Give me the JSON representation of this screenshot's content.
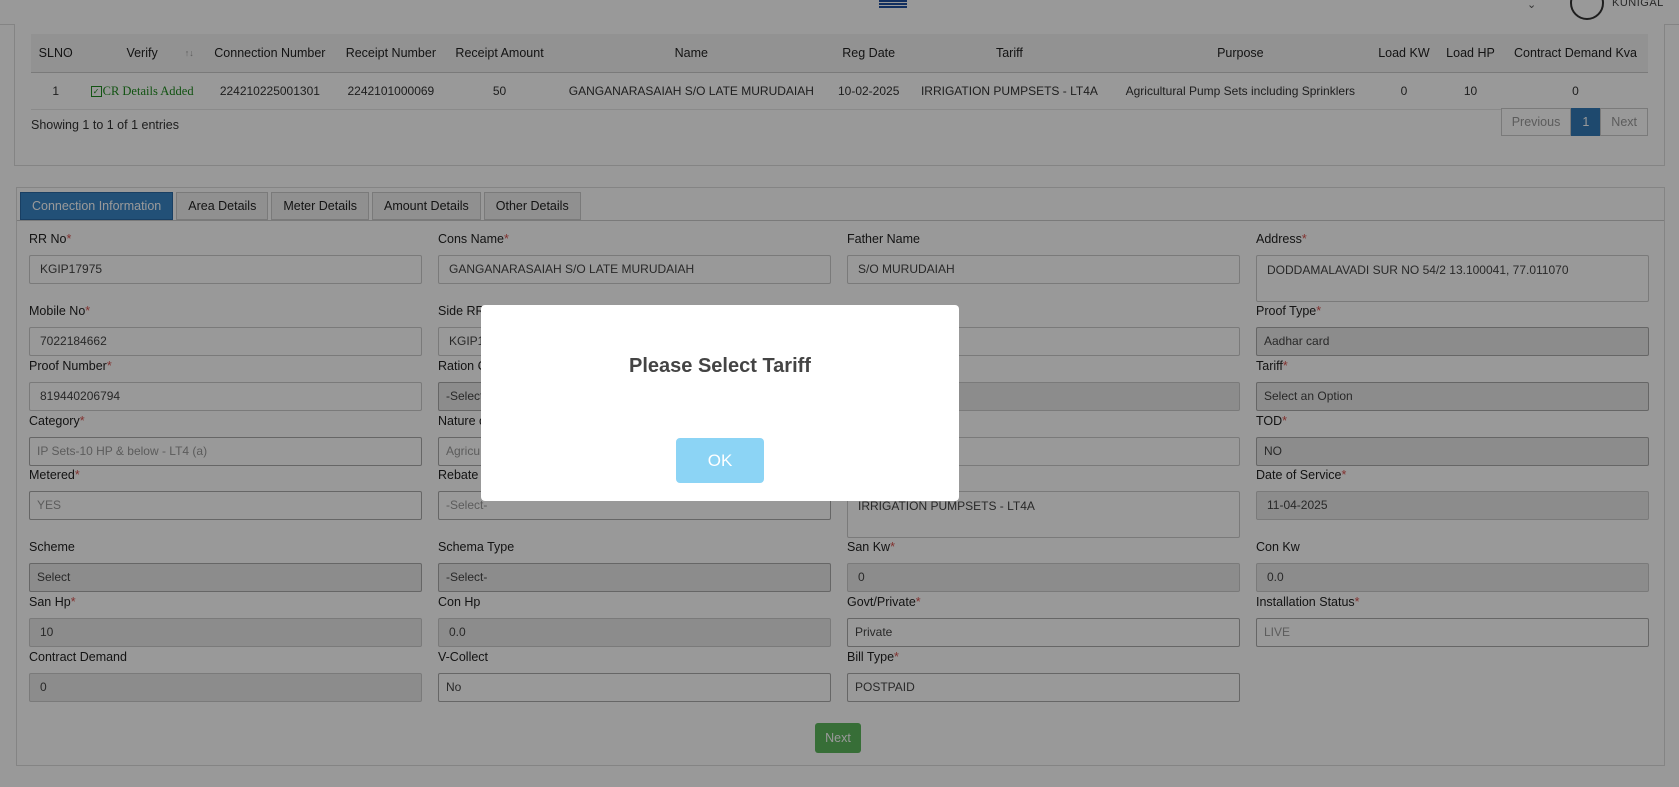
{
  "header": {
    "user_name": "KUNIGAL"
  },
  "table": {
    "columns": [
      "SLNO",
      "Verify",
      "Connection Number",
      "Receipt Number",
      "Receipt Amount",
      "Name",
      "Reg Date",
      "Tariff",
      "Purpose",
      "Load KW",
      "Load HP",
      "Contract Demand Kva"
    ],
    "rows": [
      {
        "slno": "1",
        "verify": "CR Details Added",
        "connection_number": "224210225001301",
        "receipt_number": "2242101000069",
        "receipt_amount": "50",
        "name": "GANGANARASAIAH S/O LATE MURUDAIAH",
        "reg_date": "10-02-2025",
        "tariff": "IRRIGATION PUMPSETS - LT4A",
        "purpose": "Agricultural Pump Sets including Sprinklers",
        "load_kw": "0",
        "load_hp": "10",
        "contract_demand_kva": "0"
      }
    ],
    "entries_text": "Showing 1 to 1 of 1 entries",
    "pager": {
      "previous": "Previous",
      "current": "1",
      "next": "Next"
    }
  },
  "tabs": [
    "Connection Information",
    "Area Details",
    "Meter Details",
    "Amount Details",
    "Other Details"
  ],
  "form": {
    "rr_no": {
      "label": "RR No",
      "value": "KGIP17975"
    },
    "cons_name": {
      "label": "Cons Name",
      "value": "GANGANARASAIAH S/O LATE MURUDAIAH"
    },
    "father_name": {
      "label": "Father Name",
      "value": "S/O MURUDAIAH"
    },
    "address": {
      "label": "Address",
      "value": "DODDAMALAVADI  SUR NO 54/2  13.100041, 77.011070"
    },
    "mobile_no": {
      "label": "Mobile No",
      "value": "7022184662"
    },
    "side_rr": {
      "label": "Side RRI",
      "value": "KGIP1"
    },
    "proof_type": {
      "label": "Proof Type",
      "value": "Aadhar card"
    },
    "proof_number": {
      "label": "Proof Number",
      "value": "819440206794"
    },
    "ration": {
      "label": "Ration C",
      "value": "-Select"
    },
    "tariff": {
      "label": "Tariff",
      "value": "Select an Option"
    },
    "category": {
      "label": "Category",
      "value": "IP Sets-10 HP & below - LT4 (a)"
    },
    "nature": {
      "label": "Nature o",
      "value": "Agricu"
    },
    "tod": {
      "label": "TOD",
      "value": "NO"
    },
    "metered": {
      "label": "Metered",
      "value": "YES"
    },
    "rebate": {
      "label": "Rebate",
      "value": "-Select-"
    },
    "tariff_desc": {
      "value": "IRRIGATION PUMPSETS - LT4A"
    },
    "date_of_service": {
      "label": "Date of Service",
      "value": "11-04-2025"
    },
    "scheme": {
      "label": "Scheme",
      "value": "Select"
    },
    "schema_type": {
      "label": "Schema Type",
      "value": "-Select-"
    },
    "san_kw": {
      "label": "San Kw",
      "value": "0"
    },
    "con_kw": {
      "label": "Con Kw",
      "value": "0.0"
    },
    "san_hp": {
      "label": "San Hp",
      "value": "10"
    },
    "con_hp": {
      "label": "Con Hp",
      "value": "0.0"
    },
    "govt_private": {
      "label": "Govt/Private",
      "value": "Private"
    },
    "installation_status": {
      "label": "Installation Status",
      "value": "LIVE"
    },
    "contract_demand": {
      "label": "Contract Demand",
      "value": "0"
    },
    "v_collect": {
      "label": "V-Collect",
      "value": "No"
    },
    "bill_type": {
      "label": "Bill Type",
      "value": "POSTPAID"
    },
    "next_label": "Next"
  },
  "modal": {
    "title": "Please Select Tariff",
    "ok_label": "OK"
  }
}
